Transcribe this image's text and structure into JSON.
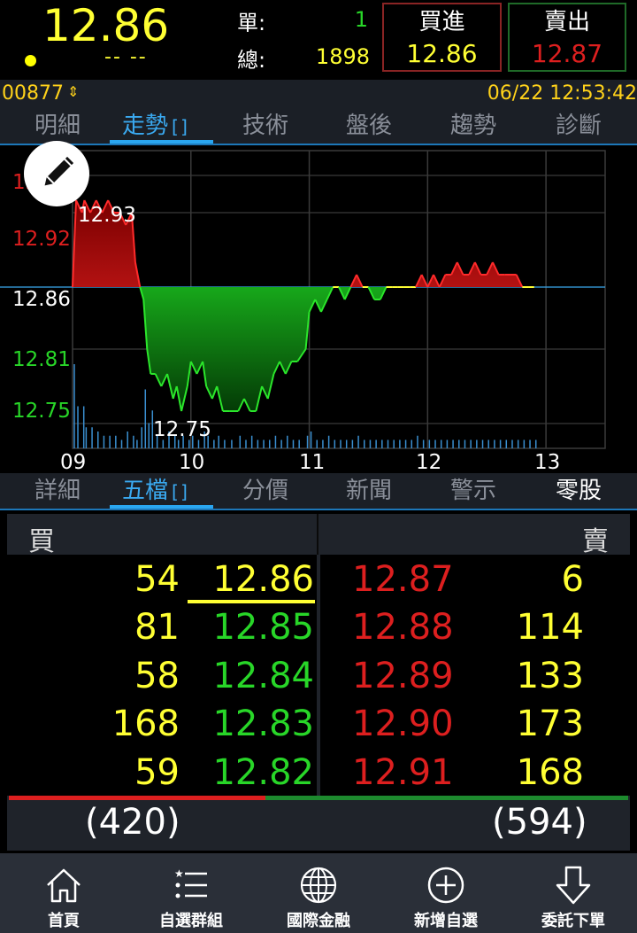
{
  "header": {
    "price": "12.86",
    "change": "-- --",
    "single_label": "單:",
    "single_value": "1",
    "total_label": "總:",
    "total_value": "1898",
    "buy_label": "買進",
    "buy_price": "12.86",
    "sell_label": "賣出",
    "sell_price": "12.87",
    "colors": {
      "price": "#ffff33",
      "up": "#dd1f1f",
      "down": "#28d628",
      "accent": "#2aa6f0"
    }
  },
  "info": {
    "code": "00877",
    "datetime": "06/22 12:53:42"
  },
  "tabs_top": [
    {
      "label": "明細"
    },
    {
      "label": "走勢"
    },
    {
      "label": "技術"
    },
    {
      "label": "盤後"
    },
    {
      "label": "趨勢"
    },
    {
      "label": "診斷"
    }
  ],
  "tabs_bottom": [
    {
      "label": "詳細"
    },
    {
      "label": "五檔"
    },
    {
      "label": "分價"
    },
    {
      "label": "新聞"
    },
    {
      "label": "警示"
    },
    {
      "label": "零股"
    }
  ],
  "chart_data": {
    "type": "line",
    "title": "",
    "xlabel": "",
    "ylabel": "",
    "ylim": [
      12.73,
      12.97
    ],
    "reference_price": 12.86,
    "y_ticks": [
      "12.92",
      "12.86",
      "12.81",
      "12.75"
    ],
    "x_ticks": [
      "09",
      "10",
      "11",
      "12",
      "13"
    ],
    "high_label": "12.93",
    "low_label": "12.75",
    "x": [
      9.0,
      9.03,
      9.08,
      9.1,
      9.15,
      9.2,
      9.25,
      9.3,
      9.35,
      9.4,
      9.45,
      9.5,
      9.53,
      9.57,
      9.6,
      9.63,
      9.66,
      9.7,
      9.75,
      9.8,
      9.85,
      9.88,
      9.92,
      9.97,
      10.0,
      10.05,
      10.1,
      10.13,
      10.18,
      10.22,
      10.27,
      10.33,
      10.4,
      10.45,
      10.5,
      10.55,
      10.6,
      10.65,
      10.7,
      10.75,
      10.8,
      10.85,
      10.9,
      10.97,
      11.0,
      11.05,
      11.1,
      11.15,
      11.2,
      11.25,
      11.3,
      11.35,
      11.4,
      11.45,
      11.5,
      11.55,
      11.6,
      11.65,
      11.7,
      11.75,
      11.8,
      11.85,
      11.9,
      11.95,
      12.0,
      12.05,
      12.1,
      12.15,
      12.2,
      12.25,
      12.3,
      12.35,
      12.4,
      12.45,
      12.5,
      12.55,
      12.6,
      12.65,
      12.7,
      12.75,
      12.8,
      12.85,
      12.9
    ],
    "values": [
      12.86,
      12.93,
      12.92,
      12.93,
      12.92,
      12.93,
      12.92,
      12.93,
      12.92,
      12.92,
      12.91,
      12.92,
      12.88,
      12.86,
      12.85,
      12.81,
      12.79,
      12.79,
      12.78,
      12.79,
      12.77,
      12.78,
      12.76,
      12.78,
      12.8,
      12.79,
      12.8,
      12.78,
      12.77,
      12.78,
      12.76,
      12.76,
      12.76,
      12.77,
      12.76,
      12.76,
      12.78,
      12.77,
      12.79,
      12.8,
      12.79,
      12.8,
      12.8,
      12.81,
      12.84,
      12.85,
      12.84,
      12.85,
      12.86,
      12.86,
      12.85,
      12.86,
      12.87,
      12.86,
      12.86,
      12.85,
      12.85,
      12.86,
      12.86,
      12.86,
      12.86,
      12.86,
      12.86,
      12.87,
      12.86,
      12.87,
      12.86,
      12.87,
      12.87,
      12.88,
      12.87,
      12.87,
      12.88,
      12.87,
      12.87,
      12.88,
      12.87,
      12.87,
      12.87,
      12.87,
      12.86,
      12.86,
      12.86
    ],
    "volume": [
      2,
      1,
      1,
      0.5,
      0.5,
      0.4,
      0.3,
      0.3,
      0.3,
      0.2,
      0.4,
      0.3,
      0.2,
      0.5,
      1.4,
      0.6,
      0.9,
      0.3,
      0.2,
      0.4,
      0.3,
      0.2,
      0.3,
      0.2,
      0.3,
      0.2,
      0.4,
      0.3,
      0.2,
      0.3,
      0.2,
      0.2,
      0.3,
      0.2,
      0.3,
      0.2,
      0.2,
      0.2,
      0.3,
      0.2,
      0.3,
      0.2,
      0.2,
      0.3,
      0.4,
      0.2,
      0.2,
      0.3,
      0.2,
      0.2,
      0.2,
      0.2,
      0.3,
      0.2,
      0.2,
      0.2,
      0.2,
      0.2,
      0.2,
      0.2,
      0.2,
      0.2,
      0.3,
      0.2,
      0.2,
      0.2,
      0.2,
      0.2,
      0.2,
      0.2,
      0.2,
      0.2,
      0.2,
      0.2,
      0.2,
      0.2,
      0.2,
      0.2,
      0.2,
      0.2,
      0.2,
      0.2,
      0.2
    ]
  },
  "orderbook": {
    "buy_label": "買",
    "sell_label": "賣",
    "rows": [
      {
        "bid_qty": "54",
        "bid_price": "12.86",
        "ask_price": "12.87",
        "ask_qty": "6"
      },
      {
        "bid_qty": "81",
        "bid_price": "12.85",
        "ask_price": "12.88",
        "ask_qty": "114"
      },
      {
        "bid_qty": "58",
        "bid_price": "12.84",
        "ask_price": "12.89",
        "ask_qty": "133"
      },
      {
        "bid_qty": "168",
        "bid_price": "12.83",
        "ask_price": "12.90",
        "ask_qty": "173"
      },
      {
        "bid_qty": "59",
        "bid_price": "12.82",
        "ask_price": "12.91",
        "ask_qty": "168"
      }
    ],
    "bid_total": "(420)",
    "ask_total": "(594)",
    "bid_ratio": 0.414
  },
  "nav": [
    {
      "label": "首頁",
      "icon": "home-icon"
    },
    {
      "label": "自選群組",
      "icon": "list-icon"
    },
    {
      "label": "國際金融",
      "icon": "globe-icon"
    },
    {
      "label": "新增自選",
      "icon": "add-icon"
    },
    {
      "label": "委託下單",
      "icon": "order-icon"
    }
  ]
}
